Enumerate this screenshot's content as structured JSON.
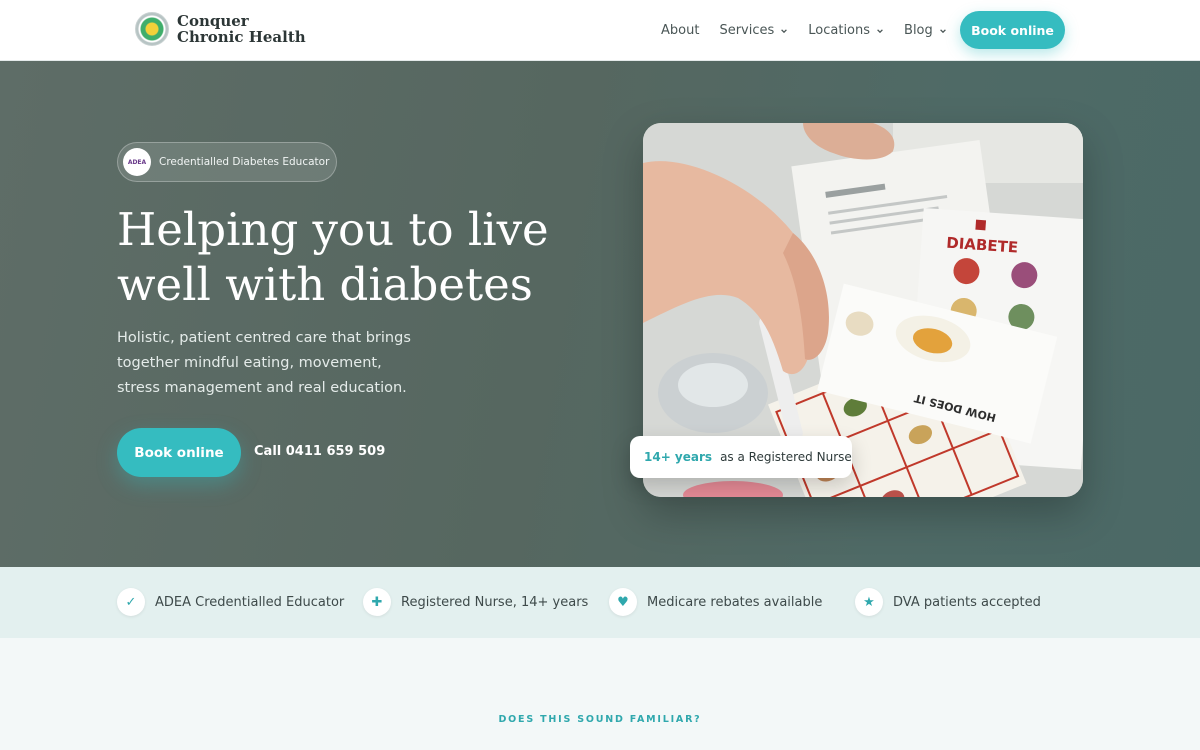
{
  "header": {
    "logo_text": "Conquer Chronic Health",
    "nav": [
      {
        "label": "About",
        "has_dropdown": false
      },
      {
        "label": "Services",
        "has_dropdown": true
      },
      {
        "label": "Locations",
        "has_dropdown": true
      },
      {
        "label": "Blog",
        "has_dropdown": true
      }
    ],
    "cta_label": "Book online"
  },
  "hero": {
    "badge_logo_text": "ADEA",
    "badge_text": "Credentialled Diabetes Educator",
    "title": "Helping you to live well with diabetes",
    "subtitle": "Holistic, patient centred care that brings together mindful eating, movement, stress management and real education.",
    "cta_label": "Book online",
    "call_label": "Call 0411 659 509",
    "image_texts": {
      "poster_title": "DIABETE",
      "booklet_heading": "HOW DOES IT"
    },
    "stat": {
      "value": "14+ years",
      "label": "as a Registered Nurse"
    }
  },
  "trust": [
    {
      "icon": "check-icon",
      "glyph": "✓",
      "label": "ADEA Credentialled Educator"
    },
    {
      "icon": "plus-icon",
      "glyph": "✚",
      "label": "Registered Nurse, 14+ years"
    },
    {
      "icon": "heart-icon",
      "glyph": "♥",
      "label": "Medicare rebates available"
    },
    {
      "icon": "star-icon",
      "glyph": "★",
      "label": "DVA patients accepted"
    }
  ],
  "section": {
    "eyebrow": "DOES THIS SOUND FAMILIAR?"
  },
  "colors": {
    "accent": "#35bcc0",
    "accent_text": "#2fa8ad",
    "hero_bg": "#566760",
    "trust_bg": "#e3f0ef"
  }
}
